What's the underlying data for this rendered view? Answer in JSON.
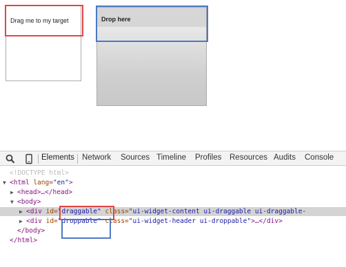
{
  "page": {
    "draggable_text": "Drag me to my target",
    "droppable_text": "Drop here"
  },
  "devtools": {
    "tabs": [
      {
        "label": "Elements",
        "active": true
      },
      {
        "label": "Network",
        "active": false
      },
      {
        "label": "Sources",
        "active": false
      },
      {
        "label": "Timeline",
        "active": false
      },
      {
        "label": "Profiles",
        "active": false
      },
      {
        "label": "Resources",
        "active": false
      },
      {
        "label": "Audits",
        "active": false
      },
      {
        "label": "Console",
        "active": false
      }
    ],
    "icons": {
      "inspect": "search-icon",
      "device": "mobile-device-icon"
    },
    "tree": {
      "doctype": "<!DOCTYPE html>",
      "html_open": "<html ",
      "html_lang_attr": "lang=",
      "html_lang_val": "\"en\"",
      "html_close_bracket": ">",
      "head": "<head>…</head>",
      "body_open": "<body>",
      "div1_open": "<div ",
      "div1_id_attr": "id=",
      "div1_id_val": "\"draggable\"",
      "div1_class_attr": "class=",
      "div1_class_val": "\"ui-widget-content ui-draggable ui-draggable-",
      "div2_open": "<div ",
      "div2_id_attr": "id=",
      "div2_id_val": "\"droppable\"",
      "div2_class_attr": "class=",
      "div2_class_val": "\"ui-widget-header ui-droppable\"",
      "div2_tail": ">…</div>",
      "body_close": "</body>",
      "html_close": "</html>"
    }
  },
  "colors": {
    "highlight_red": "#e04545",
    "highlight_blue": "#4a78c4",
    "tag": "#881280",
    "attr": "#994500",
    "value": "#1a1aa6"
  }
}
